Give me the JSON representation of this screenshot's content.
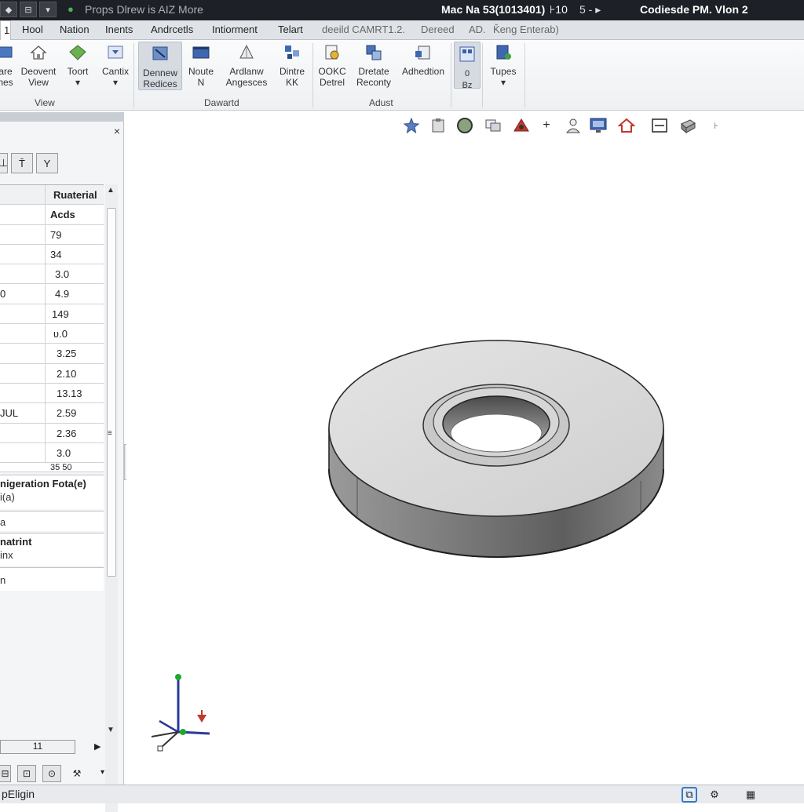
{
  "titlebar": {
    "quick_access": [
      "◆",
      "⊟",
      "▾"
    ],
    "logo_icon": "app-logo-icon",
    "title": "Props Dlrew is AIZ More",
    "info": "Mac Na 53(1013401)",
    "info2": "⊦10",
    "info3": "5 - ▸",
    "info4": "Codiesde PM. Vlon 2"
  },
  "tabs": [
    {
      "label": "1",
      "active": true
    },
    {
      "label": "Hool"
    },
    {
      "label": "Nation"
    },
    {
      "label": "Inents"
    },
    {
      "label": "Andrcetls"
    },
    {
      "label": "Intiorment"
    },
    {
      "label": "Telart"
    },
    {
      "label": "deeild CAMRT1.2."
    },
    {
      "label": "Dereed"
    },
    {
      "label": "AD."
    },
    {
      "label": "Ǩeng Enterab)"
    }
  ],
  "ribbon": {
    "buttons": [
      {
        "label": "are\nnes",
        "icon": "view-icon"
      },
      {
        "label": "Deovent\nView",
        "icon": "house-icon"
      },
      {
        "label": "Toort\n▾",
        "icon": "diamond-icon"
      },
      {
        "label": "Cantix\n▾",
        "icon": "arrow-down-box-icon"
      },
      {
        "label": "Dennew\nRedices",
        "icon": "sketch-icon",
        "selected": true
      },
      {
        "label": "Noute\nN",
        "icon": "window-icon"
      },
      {
        "label": "Ardlanw\nAngesces",
        "icon": "pyramid-icon"
      },
      {
        "label": "Dintre\nKK",
        "icon": "grid-node-icon"
      },
      {
        "label": "OOKC\nDetrel",
        "icon": "gear-doc-icon"
      },
      {
        "label": "Dretate\nReconty",
        "icon": "cube-stack-icon"
      },
      {
        "label": "Adhedtion",
        "icon": "dimension-icon"
      },
      {
        "label": "0\nBz",
        "icon": "layout-icon",
        "selected": true
      },
      {
        "label": "Tupes\n▾",
        "icon": "page-plus-icon"
      }
    ],
    "groups": [
      "View",
      "Dawartd",
      "Adust"
    ]
  },
  "panel": {
    "close": "×",
    "toolbar": [
      "⊥",
      "T̄",
      "Y"
    ],
    "table": {
      "header": [
        "",
        "Ruaterial"
      ],
      "rows": [
        [
          "",
          "Acds"
        ],
        [
          "",
          "79"
        ],
        [
          "",
          "34"
        ],
        [
          "",
          "3.0"
        ],
        [
          "0",
          "4.9"
        ],
        [
          "",
          "149"
        ],
        [
          "",
          "ʋ.0"
        ],
        [
          "",
          "3.25"
        ],
        [
          "",
          "2.10"
        ],
        [
          "",
          "13.13"
        ],
        [
          "JUL",
          "2.59"
        ],
        [
          "",
          "2.36"
        ],
        [
          "",
          "3.0"
        ]
      ]
    },
    "partial_row": "35 50",
    "section1": {
      "heading": "nigeration Fota(e)",
      "sub": "i(a)",
      "sub2": "a"
    },
    "section2": {
      "heading": "natrint",
      "sub": "inx",
      "sub2": "n"
    },
    "hscroll_label": "11",
    "hscroll_arrow": "▶",
    "bottom_tabs": [
      "⊟",
      "⊡",
      "⊙",
      "⚒"
    ]
  },
  "viewport": {
    "toolbar_icons": [
      "star-icon",
      "clipboard-icon",
      "sphere-icon",
      "layers-icon",
      "triangle-icon",
      "plus-icon",
      "person-icon",
      "monitor-icon",
      "home-icon",
      "minus-box-icon",
      "block-icon",
      "hand-icon"
    ],
    "model": "washer-part"
  },
  "statusbar": {
    "text": "pEligin",
    "icons": [
      "copy-icon",
      "settings-icon",
      "grid-icon"
    ]
  },
  "colors": {
    "title_bg": "#1d2026",
    "ribbon_bg": "#f4f5f7",
    "accent_red": "#c0392b",
    "axis_blue": "#2a3a9a",
    "axis_green": "#1fa82c"
  }
}
